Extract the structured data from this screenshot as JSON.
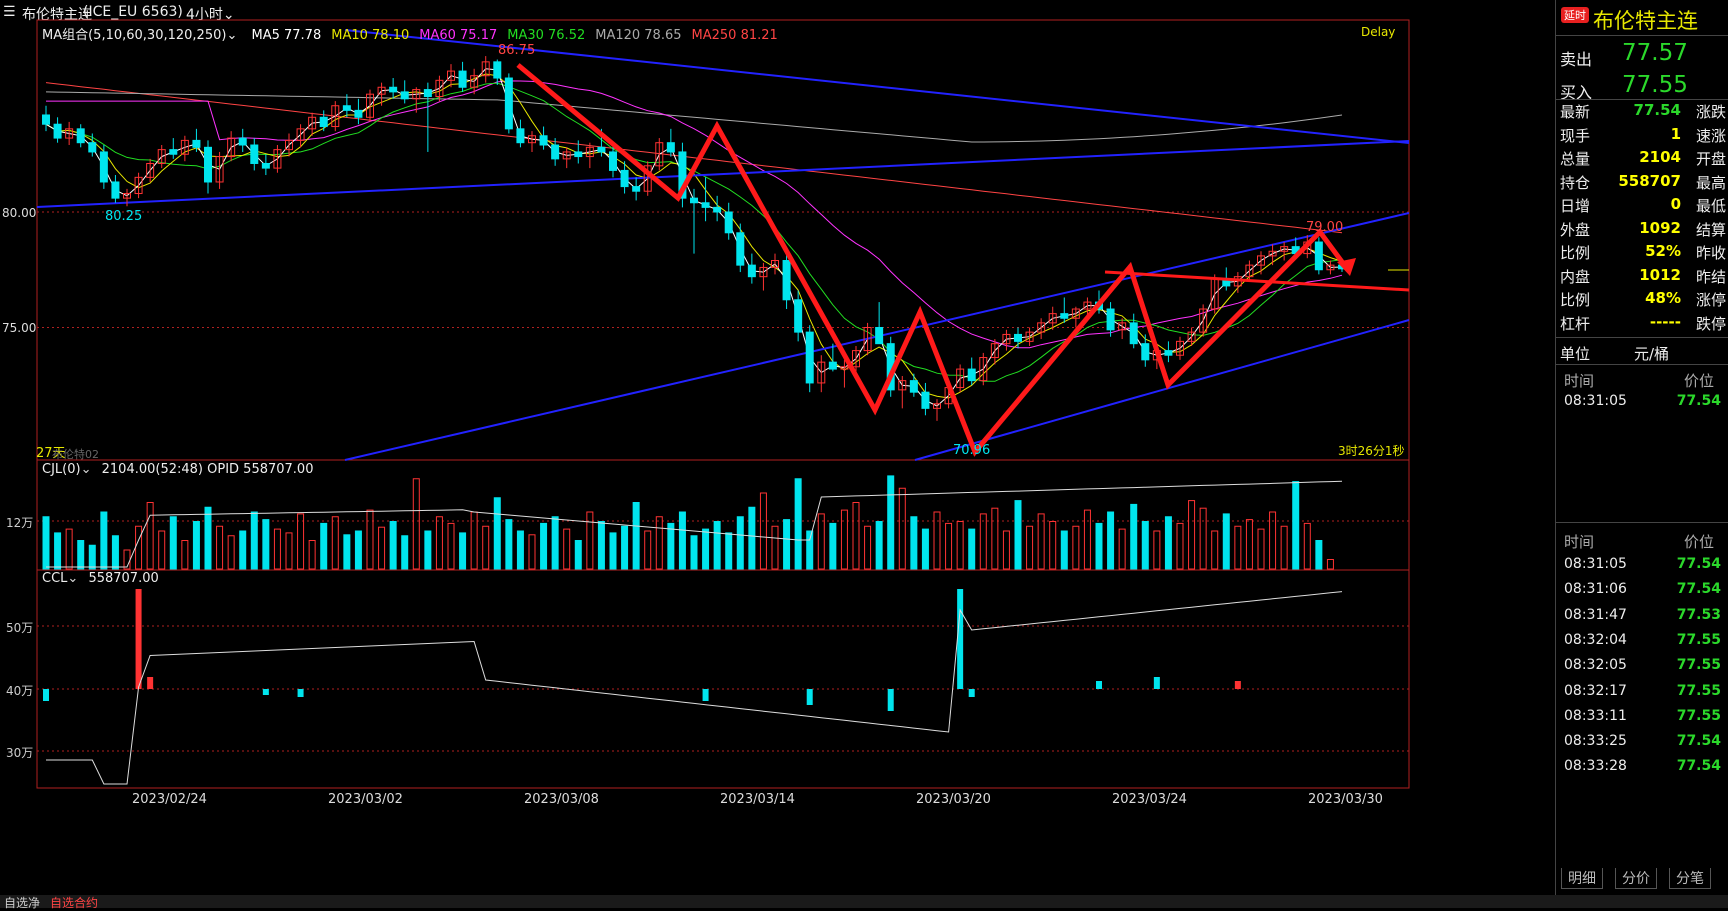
{
  "instrument": {
    "name": "布伦特主连",
    "code": "(ICE_EU 6563)",
    "period": "4小时",
    "badge": "延时",
    "delay_label": "Delay"
  },
  "ma_legend": {
    "group": "MA组合(5,10,60,30,120,250)",
    "items": [
      {
        "label": "MA5 77.78",
        "color": "#ffffff"
      },
      {
        "label": "MA10 78.10",
        "color": "#e8e800"
      },
      {
        "label": "MA60 75.17",
        "color": "#ff33ff"
      },
      {
        "label": "MA30 76.52",
        "color": "#22dd22"
      },
      {
        "label": "MA120 78.65",
        "color": "#aaaaaa"
      },
      {
        "label": "MA250 81.21",
        "color": "#ff4444"
      }
    ]
  },
  "price_axis": {
    "labels": [
      "80.00",
      "75.00"
    ]
  },
  "annotations": {
    "high": "86.75",
    "low_left": "80.25",
    "low": "70.96",
    "right_high": "79.00",
    "days": "27天",
    "countdown": "3时26分1秒",
    "watermark": "布伦特02"
  },
  "volume_panel": {
    "title": "CJL(0)",
    "values": "2104.00(52:48)  OPID 558707.00",
    "axis": [
      "12万"
    ]
  },
  "oi_panel": {
    "title": "CCL",
    "value": "558707.00",
    "axis": [
      "50万",
      "40万",
      "30万"
    ]
  },
  "date_axis": [
    "2023/02/24",
    "2023/03/02",
    "2023/03/08",
    "2023/03/14",
    "2023/03/20",
    "2023/03/24",
    "2023/03/30"
  ],
  "quote": {
    "sell_label": "卖出",
    "sell": "77.57",
    "buy_label": "买入",
    "buy": "77.55",
    "rows": [
      {
        "k": "最新",
        "v": "77.54",
        "c": "#2bd92b",
        "k2": "涨跌"
      },
      {
        "k": "现手",
        "v": "1",
        "c": "#ffff00",
        "k2": "速涨"
      },
      {
        "k": "总量",
        "v": "2104",
        "c": "#ffff00",
        "k2": "开盘"
      },
      {
        "k": "持仓",
        "v": "558707",
        "c": "#ffff00",
        "k2": "最高"
      },
      {
        "k": "日增",
        "v": "0",
        "c": "#ffff00",
        "k2": "最低"
      },
      {
        "k": "外盘",
        "v": "1092",
        "c": "#ffff00",
        "k2": "结算"
      },
      {
        "k": "比例",
        "v": "52%",
        "c": "#ffff00",
        "k2": "昨收"
      },
      {
        "k": "内盘",
        "v": "1012",
        "c": "#ffff00",
        "k2": "昨结"
      },
      {
        "k": "比例",
        "v": "48%",
        "c": "#ffff00",
        "k2": "涨停"
      },
      {
        "k": "杠杆",
        "v": "-----",
        "c": "#ffff00",
        "k2": "跌停"
      }
    ],
    "unit_label": "单位",
    "unit": "元/桶"
  },
  "tick_header": {
    "time": "时间",
    "price": "价位"
  },
  "ticks_top": [
    {
      "time": "08:31:05",
      "price": "77.54"
    }
  ],
  "ticks": [
    {
      "time": "08:31:05",
      "price": "77.54"
    },
    {
      "time": "08:31:06",
      "price": "77.54"
    },
    {
      "time": "08:31:47",
      "price": "77.53"
    },
    {
      "time": "08:32:04",
      "price": "77.55"
    },
    {
      "time": "08:32:05",
      "price": "77.55"
    },
    {
      "time": "08:32:17",
      "price": "77.55"
    },
    {
      "time": "08:33:11",
      "price": "77.55"
    },
    {
      "time": "08:33:25",
      "price": "77.54"
    },
    {
      "time": "08:33:28",
      "price": "77.54"
    }
  ],
  "tabs": [
    "明细",
    "分价",
    "分笔"
  ],
  "bottom": {
    "left": "自选净",
    "mid": "自选合约"
  },
  "colors": {
    "up": "#ff3333",
    "down": "#00e5ee",
    "trend": "#2222ff",
    "arrow": "#ff1a1a"
  },
  "candles": [
    [
      84.2,
      84.6,
      83.5,
      83.8
    ],
    [
      83.8,
      84.1,
      83.0,
      83.2
    ],
    [
      83.2,
      83.9,
      82.9,
      83.6
    ],
    [
      83.6,
      83.8,
      82.8,
      83.0
    ],
    [
      83.0,
      83.4,
      82.4,
      82.6
    ],
    [
      82.6,
      82.9,
      81.0,
      81.3
    ],
    [
      81.3,
      81.6,
      80.4,
      80.6
    ],
    [
      80.6,
      81.0,
      80.25,
      80.8
    ],
    [
      80.8,
      81.7,
      80.6,
      81.5
    ],
    [
      81.5,
      82.3,
      81.3,
      82.1
    ],
    [
      82.1,
      82.9,
      81.9,
      82.7
    ],
    [
      82.7,
      83.2,
      82.3,
      82.5
    ],
    [
      82.5,
      83.3,
      82.2,
      83.1
    ],
    [
      83.1,
      83.6,
      82.6,
      82.8
    ],
    [
      82.8,
      83.1,
      80.8,
      81.3
    ],
    [
      81.3,
      82.6,
      81.0,
      82.4
    ],
    [
      82.4,
      83.5,
      82.2,
      83.2
    ],
    [
      83.2,
      83.6,
      82.6,
      82.9
    ],
    [
      82.9,
      83.2,
      81.8,
      82.1
    ],
    [
      82.1,
      82.5,
      81.6,
      81.9
    ],
    [
      81.9,
      82.9,
      81.7,
      82.7
    ],
    [
      82.7,
      83.4,
      82.4,
      83.1
    ],
    [
      83.1,
      83.8,
      82.8,
      83.6
    ],
    [
      83.6,
      84.3,
      83.3,
      84.1
    ],
    [
      84.1,
      84.4,
      83.5,
      83.7
    ],
    [
      83.7,
      84.8,
      83.5,
      84.6
    ],
    [
      84.6,
      85.1,
      84.1,
      84.4
    ],
    [
      84.4,
      84.9,
      83.8,
      84.1
    ],
    [
      84.1,
      85.3,
      83.9,
      85.1
    ],
    [
      85.1,
      85.6,
      84.6,
      85.4
    ],
    [
      85.4,
      85.8,
      84.9,
      85.2
    ],
    [
      85.2,
      85.7,
      84.7,
      84.9
    ],
    [
      84.9,
      85.4,
      84.3,
      85.3
    ],
    [
      85.3,
      85.6,
      82.6,
      85.0
    ],
    [
      85.0,
      85.9,
      84.8,
      85.7
    ],
    [
      85.7,
      86.4,
      85.4,
      86.1
    ],
    [
      86.1,
      86.5,
      85.2,
      85.4
    ],
    [
      85.4,
      86.2,
      85.1,
      85.9
    ],
    [
      85.9,
      86.75,
      85.6,
      86.5
    ],
    [
      86.5,
      86.6,
      85.5,
      85.8
    ],
    [
      85.8,
      86.0,
      83.4,
      83.6
    ],
    [
      83.6,
      84.0,
      82.8,
      83.0
    ],
    [
      83.0,
      83.5,
      82.6,
      83.3
    ],
    [
      83.3,
      83.7,
      82.7,
      82.9
    ],
    [
      82.9,
      83.2,
      82.0,
      82.3
    ],
    [
      82.3,
      82.8,
      81.9,
      82.6
    ],
    [
      82.6,
      83.1,
      82.1,
      82.4
    ],
    [
      82.4,
      83.0,
      81.9,
      82.8
    ],
    [
      82.8,
      83.6,
      82.4,
      82.6
    ],
    [
      82.6,
      82.9,
      81.5,
      81.8
    ],
    [
      81.8,
      82.2,
      80.8,
      81.1
    ],
    [
      81.1,
      81.5,
      80.5,
      80.9
    ],
    [
      80.9,
      82.2,
      80.7,
      82.0
    ],
    [
      82.0,
      83.2,
      81.8,
      83.0
    ],
    [
      83.0,
      83.6,
      82.4,
      82.6
    ],
    [
      82.6,
      83.0,
      80.2,
      80.6
    ],
    [
      80.6,
      81.0,
      78.2,
      80.4
    ],
    [
      80.4,
      81.5,
      79.6,
      80.2
    ],
    [
      80.2,
      80.7,
      79.6,
      80.0
    ],
    [
      80.0,
      80.4,
      78.8,
      79.1
    ],
    [
      79.1,
      79.5,
      77.4,
      77.7
    ],
    [
      77.7,
      78.2,
      76.9,
      77.2
    ],
    [
      77.2,
      77.8,
      76.6,
      77.6
    ],
    [
      77.6,
      78.2,
      77.3,
      77.9
    ],
    [
      77.9,
      78.3,
      75.8,
      76.2
    ],
    [
      76.2,
      76.6,
      74.4,
      74.8
    ],
    [
      74.8,
      75.1,
      72.2,
      72.6
    ],
    [
      72.6,
      73.8,
      72.2,
      73.5
    ],
    [
      73.5,
      74.3,
      73.1,
      73.2
    ],
    [
      73.2,
      73.6,
      72.4,
      73.3
    ],
    [
      73.3,
      74.2,
      73.0,
      74.0
    ],
    [
      74.0,
      75.2,
      73.8,
      75.0
    ],
    [
      75.0,
      76.1,
      74.6,
      74.3
    ],
    [
      74.3,
      74.6,
      72.0,
      72.3
    ],
    [
      72.3,
      72.9,
      71.5,
      72.7
    ],
    [
      72.7,
      73.0,
      72.0,
      72.2
    ],
    [
      72.2,
      72.6,
      71.2,
      71.5
    ],
    [
      71.5,
      71.9,
      70.96,
      71.7
    ],
    [
      71.7,
      72.6,
      71.5,
      72.4
    ],
    [
      72.4,
      73.4,
      72.2,
      73.2
    ],
    [
      73.2,
      73.7,
      72.5,
      72.7
    ],
    [
      72.7,
      73.9,
      72.5,
      73.7
    ],
    [
      73.7,
      74.5,
      73.4,
      74.3
    ],
    [
      74.3,
      74.9,
      74.0,
      74.7
    ],
    [
      74.7,
      75.0,
      74.1,
      74.4
    ],
    [
      74.4,
      75.0,
      74.2,
      74.8
    ],
    [
      74.8,
      75.4,
      74.5,
      75.2
    ],
    [
      75.2,
      75.9,
      74.9,
      75.6
    ],
    [
      75.6,
      76.3,
      75.2,
      75.4
    ],
    [
      75.4,
      75.9,
      75.0,
      75.8
    ],
    [
      75.8,
      76.3,
      75.5,
      76.1
    ],
    [
      76.1,
      76.6,
      75.6,
      75.8
    ],
    [
      75.8,
      76.1,
      74.6,
      74.9
    ],
    [
      74.9,
      75.4,
      74.5,
      75.2
    ],
    [
      75.2,
      75.6,
      74.1,
      74.3
    ],
    [
      74.3,
      74.7,
      73.3,
      73.6
    ],
    [
      73.6,
      74.2,
      73.2,
      74.0
    ],
    [
      74.0,
      74.4,
      73.5,
      73.8
    ],
    [
      73.8,
      74.6,
      73.6,
      74.4
    ],
    [
      74.4,
      75.0,
      74.2,
      74.8
    ],
    [
      74.8,
      76.0,
      74.6,
      75.8
    ],
    [
      75.8,
      77.3,
      75.6,
      77.1
    ],
    [
      77.1,
      77.6,
      76.6,
      76.8
    ],
    [
      76.8,
      77.4,
      76.5,
      77.2
    ],
    [
      77.2,
      77.9,
      77.0,
      77.7
    ],
    [
      77.7,
      78.3,
      77.3,
      78.1
    ],
    [
      78.1,
      78.6,
      77.7,
      78.3
    ],
    [
      78.3,
      78.7,
      77.9,
      78.5
    ],
    [
      78.5,
      78.9,
      78.0,
      78.2
    ],
    [
      78.2,
      79.0,
      78.0,
      78.7
    ],
    [
      78.7,
      78.9,
      77.3,
      77.5
    ],
    [
      77.5,
      77.9,
      77.3,
      77.7
    ],
    [
      77.7,
      77.8,
      77.4,
      77.54
    ]
  ],
  "volumes": [
    55,
    38,
    42,
    30,
    25,
    60,
    35,
    20,
    45,
    70,
    40,
    55,
    30,
    50,
    65,
    45,
    35,
    40,
    60,
    52,
    42,
    38,
    58,
    30,
    48,
    55,
    36,
    40,
    62,
    44,
    50,
    35,
    95,
    40,
    55,
    48,
    38,
    60,
    45,
    75,
    52,
    40,
    36,
    48,
    55,
    42,
    30,
    60,
    50,
    38,
    45,
    70,
    40,
    55,
    48,
    60,
    35,
    42,
    50,
    38,
    55,
    65,
    80,
    45,
    52,
    95,
    40,
    58,
    48,
    62,
    70,
    45,
    50,
    98,
    85,
    55,
    42,
    60,
    48,
    50,
    42,
    58,
    64,
    40,
    72,
    45,
    58,
    50,
    40,
    45,
    62,
    48,
    60,
    42,
    68,
    50,
    40,
    55,
    48,
    72,
    64,
    40,
    58,
    45,
    52,
    42,
    60,
    45,
    92,
    48,
    30,
    10
  ],
  "oi_bars": [
    -12,
    0,
    0,
    0,
    0,
    0,
    0,
    0,
    100,
    12,
    0,
    0,
    0,
    0,
    0,
    0,
    0,
    0,
    0,
    -6,
    0,
    0,
    0,
    0,
    0,
    0,
    0,
    0,
    0,
    0,
    0,
    0,
    0,
    0,
    0,
    0,
    0,
    0,
    0,
    0,
    0,
    0,
    0,
    0,
    0,
    0,
    0,
    0,
    0,
    0,
    0,
    0,
    0,
    0,
    0,
    0,
    0,
    0,
    0,
    0,
    0,
    0,
    0,
    0,
    0,
    0,
    0,
    0,
    0,
    0,
    0,
    0,
    0,
    0,
    0,
    0,
    0,
    0,
    0,
    0,
    0,
    0,
    0,
    0,
    0,
    0,
    0,
    0,
    0,
    0,
    0,
    0,
    0,
    0,
    0,
    0,
    0,
    0,
    0,
    0,
    0,
    0,
    0,
    0,
    0,
    0,
    0,
    0,
    0,
    0,
    0,
    0
  ]
}
